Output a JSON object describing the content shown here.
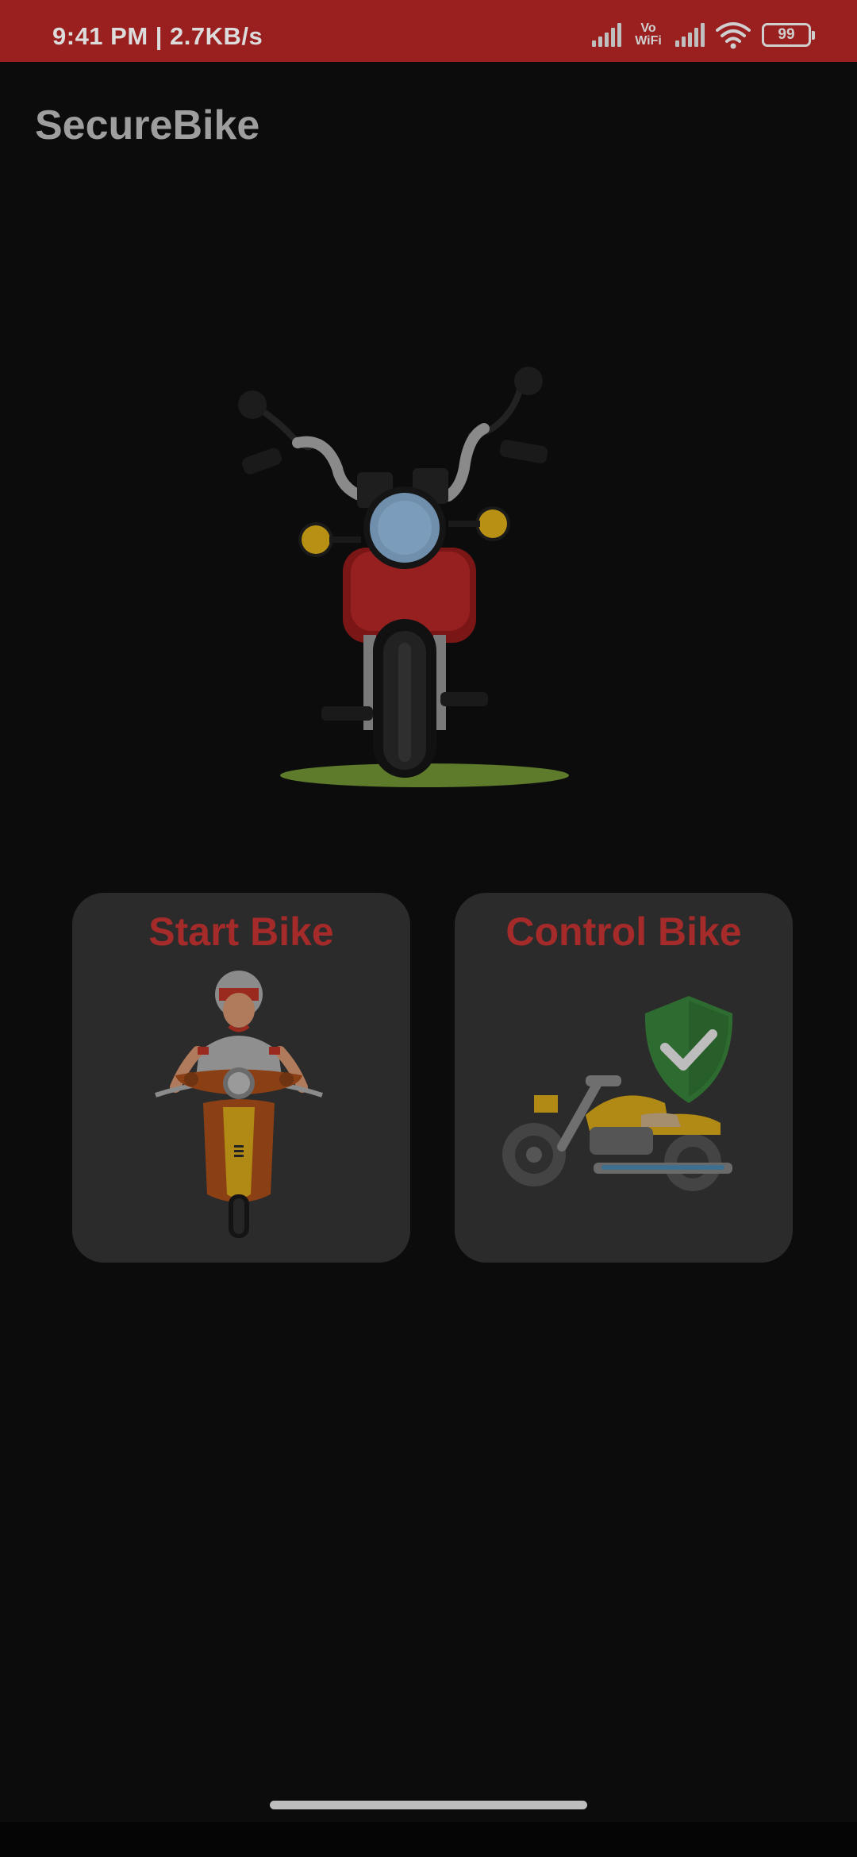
{
  "status_bar": {
    "time_speed": "9:41 PM | 2.7KB/s",
    "vowifi_top": "Vo",
    "vowifi_bottom": "WiFi",
    "battery": "99"
  },
  "app": {
    "title": "SecureBike"
  },
  "hero": {
    "icon": "motorcycle-front-illustration"
  },
  "cards": {
    "start": {
      "label": "Start Bike",
      "icon": "rider-on-scooter-illustration"
    },
    "control": {
      "label": "Control Bike",
      "icon": "motorcycle-with-shield-check-illustration"
    }
  },
  "colors": {
    "status_bar": "#9a2020",
    "background": "#0c0c0c",
    "card_background": "#2b2b2b",
    "card_label": "#a52a2a",
    "title": "#9e9e9e"
  }
}
